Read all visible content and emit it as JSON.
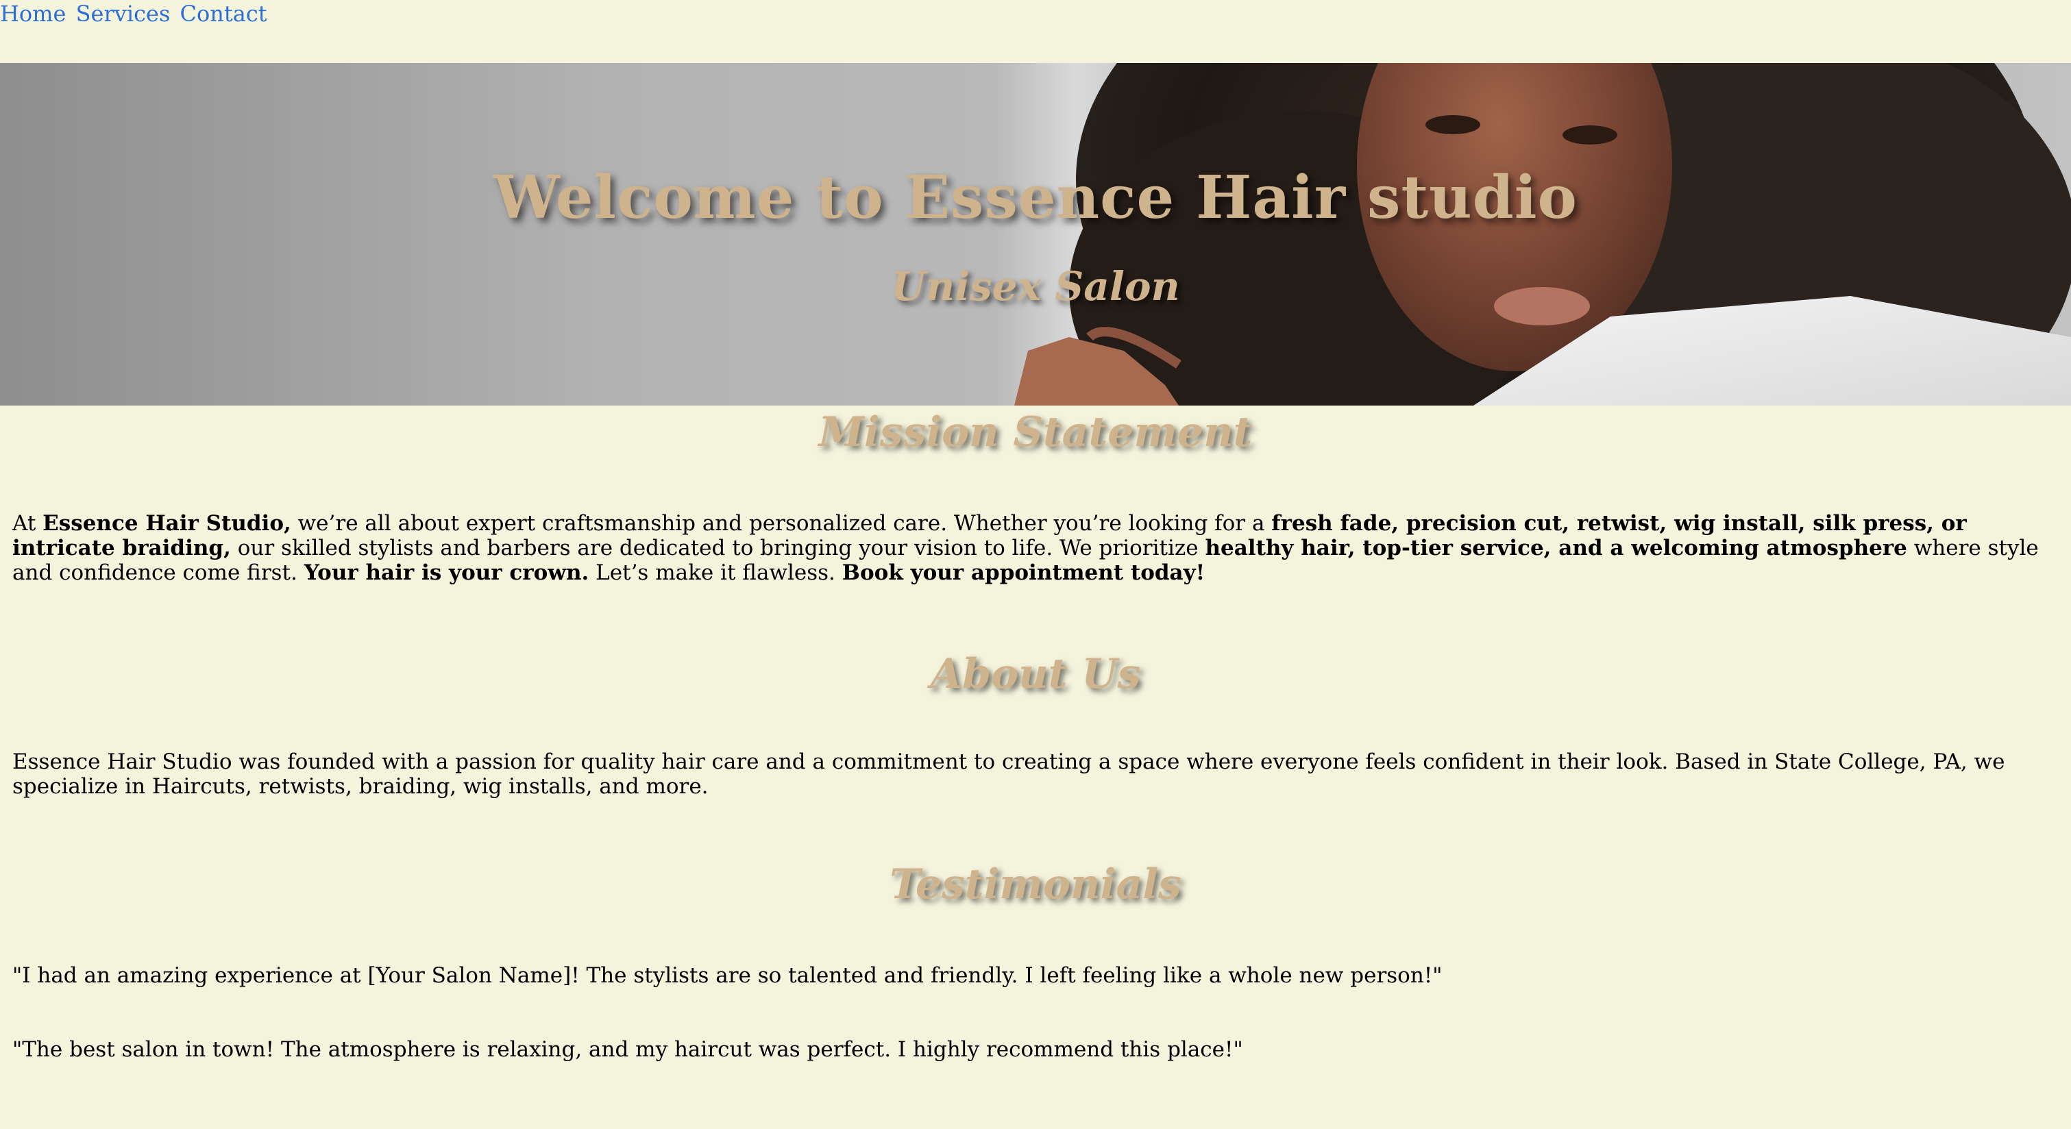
{
  "nav": {
    "home": "Home",
    "services": "Services",
    "contact": "Contact"
  },
  "hero": {
    "title": "Welcome to Essence Hair studio",
    "subtitle": "Unisex Salon"
  },
  "mission": {
    "heading": "Mission Statement",
    "p1": "At ",
    "b1": "Essence Hair Studio,",
    "p2": " we’re all about expert craftsmanship and personalized care. Whether you’re looking for a ",
    "b2": "fresh fade, precision cut, retwist, wig install, silk press, or intricate braiding,",
    "p3": " our skilled stylists and barbers are dedicated to bringing your vision to life. We prioritize ",
    "b3": "healthy hair, top-tier service, and a welcoming atmosphere",
    "p4": " where style and confidence come first. ",
    "b4": "Your hair is your crown.",
    "p5": " Let’s make it flawless. ",
    "b5": "Book your appointment today!"
  },
  "about": {
    "heading": "About Us",
    "text": "Essence Hair Studio was founded with a passion for quality hair care and a commitment to creating a space where everyone feels confident in their look. Based in State College, PA, we specialize in Haircuts, retwists, braiding, wig installs, and more."
  },
  "testimonials": {
    "heading": "Testimonials",
    "items": [
      "\"I had an amazing experience at [Your Salon Name]! The stylists are so talented and friendly. I left feeling like a whole new person!\"",
      "\"The best salon in town! The atmosphere is relaxing, and my haircut was perfect. I highly recommend this place!\""
    ]
  },
  "colors": {
    "page_background": "#f4f3dc",
    "link": "#2b6fd6",
    "heading_gold": "#cfb38c"
  }
}
